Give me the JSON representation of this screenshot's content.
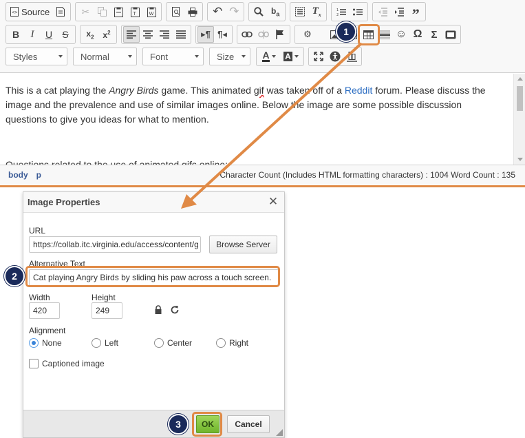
{
  "toolbar": {
    "source_label": "Source",
    "styles_label": "Styles",
    "format_label": "Normal",
    "font_label": "Font",
    "size_label": "Size"
  },
  "editor": {
    "para1_pre": "This is a cat playing the ",
    "para1_em": "Angry Birds",
    "para1_mid": " game.  This animated ",
    "para1_spell": "gif",
    "para1_mid2": " was taken off of a ",
    "para1_link": "Reddit",
    "para1_post": " forum.  Please discuss the image and the prevalence and use of similar images online.  Below the image are some possible discussion questions to give you ideas for what to mention.",
    "next_line": "Questions related to the use of animated gifs online:"
  },
  "statusbar": {
    "path": [
      "body",
      "p"
    ],
    "counts": "Character Count (Includes HTML formatting characters) : 1004 Word Count : 135"
  },
  "dialog": {
    "title": "Image Properties",
    "url_label": "URL",
    "url_value": "https://collab.itc.virginia.edu/access/content/g",
    "browse_label": "Browse Server",
    "alt_label": "Alternative Text",
    "alt_value": "Cat playing Angry Birds by sliding his paw across a touch screen.",
    "width_label": "Width",
    "width_value": "420",
    "height_label": "Height",
    "height_value": "249",
    "alignment_label": "Alignment",
    "align_options": [
      "None",
      "Left",
      "Center",
      "Right"
    ],
    "captioned_label": "Captioned image",
    "ok_label": "OK",
    "cancel_label": "Cancel"
  },
  "callouts": {
    "step1": "1",
    "step2": "2",
    "step3": "3",
    "color": "#e08a46",
    "badge_color": "#1a2a5a"
  }
}
